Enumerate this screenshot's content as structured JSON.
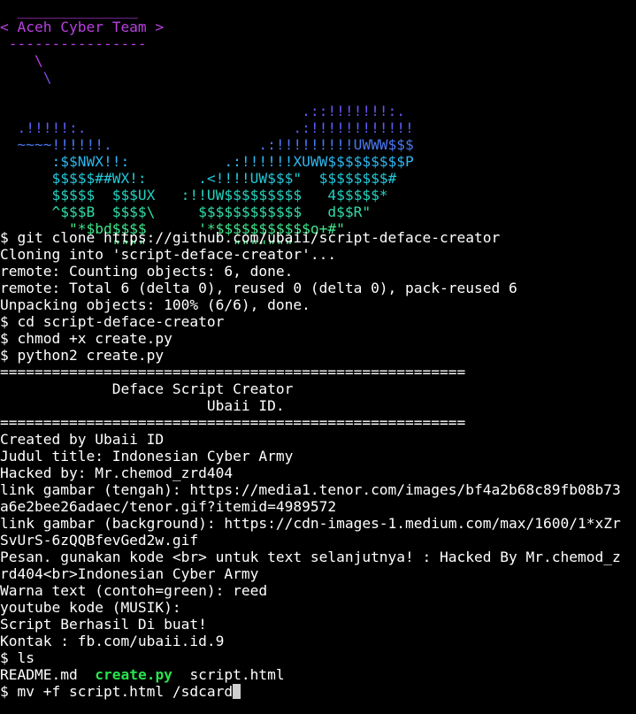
{
  "banner": {
    "lines": [
      {
        "text": "  ______________",
        "color": "#b93fe0"
      },
      {
        "text": "< Aceh Cyber Team >",
        "color": "#b93fe0"
      },
      {
        "text": " ----------------",
        "color": "#b93fe0"
      },
      {
        "text": "    \\",
        "color": "#b93fe0"
      },
      {
        "text": "     \\",
        "color": "#7a4fe8"
      },
      {
        "text": "",
        "color": "#7a4fe8"
      },
      {
        "text": "                                   .::!!!!!!!:.",
        "color": "#6a55f0"
      },
      {
        "text": "  .!!!!!:.                        .:!!!!!!!!!!!!",
        "color": "#5a5cf4"
      },
      {
        "text": "  ~~~~!!!!!!.                 .:!!!!!!!!!UWWW$$$",
        "color": "#4a78f2"
      },
      {
        "text": "      :$$NWX!!:           .:!!!!!!XUWW$$$$$$$$$P",
        "color": "#2fb6ee"
      },
      {
        "text": "      $$$$$##WX!:      .<!!!!UW$$$\"  $$$$$$$$#",
        "color": "#23c8d8"
      },
      {
        "text": "      $$$$$  $$$UX   :!!UW$$$$$$$$$   4$$$$$*",
        "color": "#23d3c0"
      },
      {
        "text": "      ^$$$B  $$$$\\     $$$$$$$$$$$$   d$$R\"",
        "color": "#30dca8"
      },
      {
        "text": "        \"*$bd$$$$      '*$$$$$$$$$$$o+#\"",
        "color": "#3fe68a"
      },
      {
        "text": "             \"\"\"\"          \"\"\"\"\"\"\"",
        "color": "#4fe88a"
      }
    ]
  },
  "output_lines": [
    "$ git clone https://github.com/ubaii/script-deface-creator",
    "Cloning into 'script-deface-creator'...",
    "remote: Counting objects: 6, done.",
    "remote: Total 6 (delta 0), reused 0 (delta 0), pack-reused 6",
    "Unpacking objects: 100% (6/6), done.",
    "$ cd script-deface-creator",
    "$ chmod +x create.py",
    "$ python2 create.py",
    "======================================================",
    "             Deface Script Creator",
    "                        Ubaii ID.",
    "======================================================",
    "Created by Ubaii ID",
    "Judul title: Indonesian Cyber Army",
    "Hacked by: Mr.chemod_zrd404",
    "link gambar (tengah): https://media1.tenor.com/images/bf4a2b68c89fb08b73",
    "a6e2bee26adaec/tenor.gif?itemid=4989572",
    "link gambar (background): https://cdn-images-1.medium.com/max/1600/1*xZr",
    "SvUrS-6zQQBfevGed2w.gif",
    "Pesan. gunakan kode <br> untuk text selanjutnya! : Hacked By Mr.chemod_z",
    "rd404<br>Indonesian Cyber Army",
    "Warna text (contoh=green): reed",
    "youtube kode (MUSIK):",
    "Script Berhasil Di buat!",
    "Kontak : fb.com/ubaii.id.9",
    "$ ls"
  ],
  "ls_output": {
    "file1": "README.md",
    "sep1": "  ",
    "file2": "create.py",
    "sep2": "  ",
    "file3": "script.html"
  },
  "prompt": {
    "text": "$ mv +f script.html /sdcard"
  },
  "colors": {
    "background": "#000000",
    "foreground": "#ffffff",
    "executable": "#27e34d",
    "cursor": "#cfcfcf"
  }
}
